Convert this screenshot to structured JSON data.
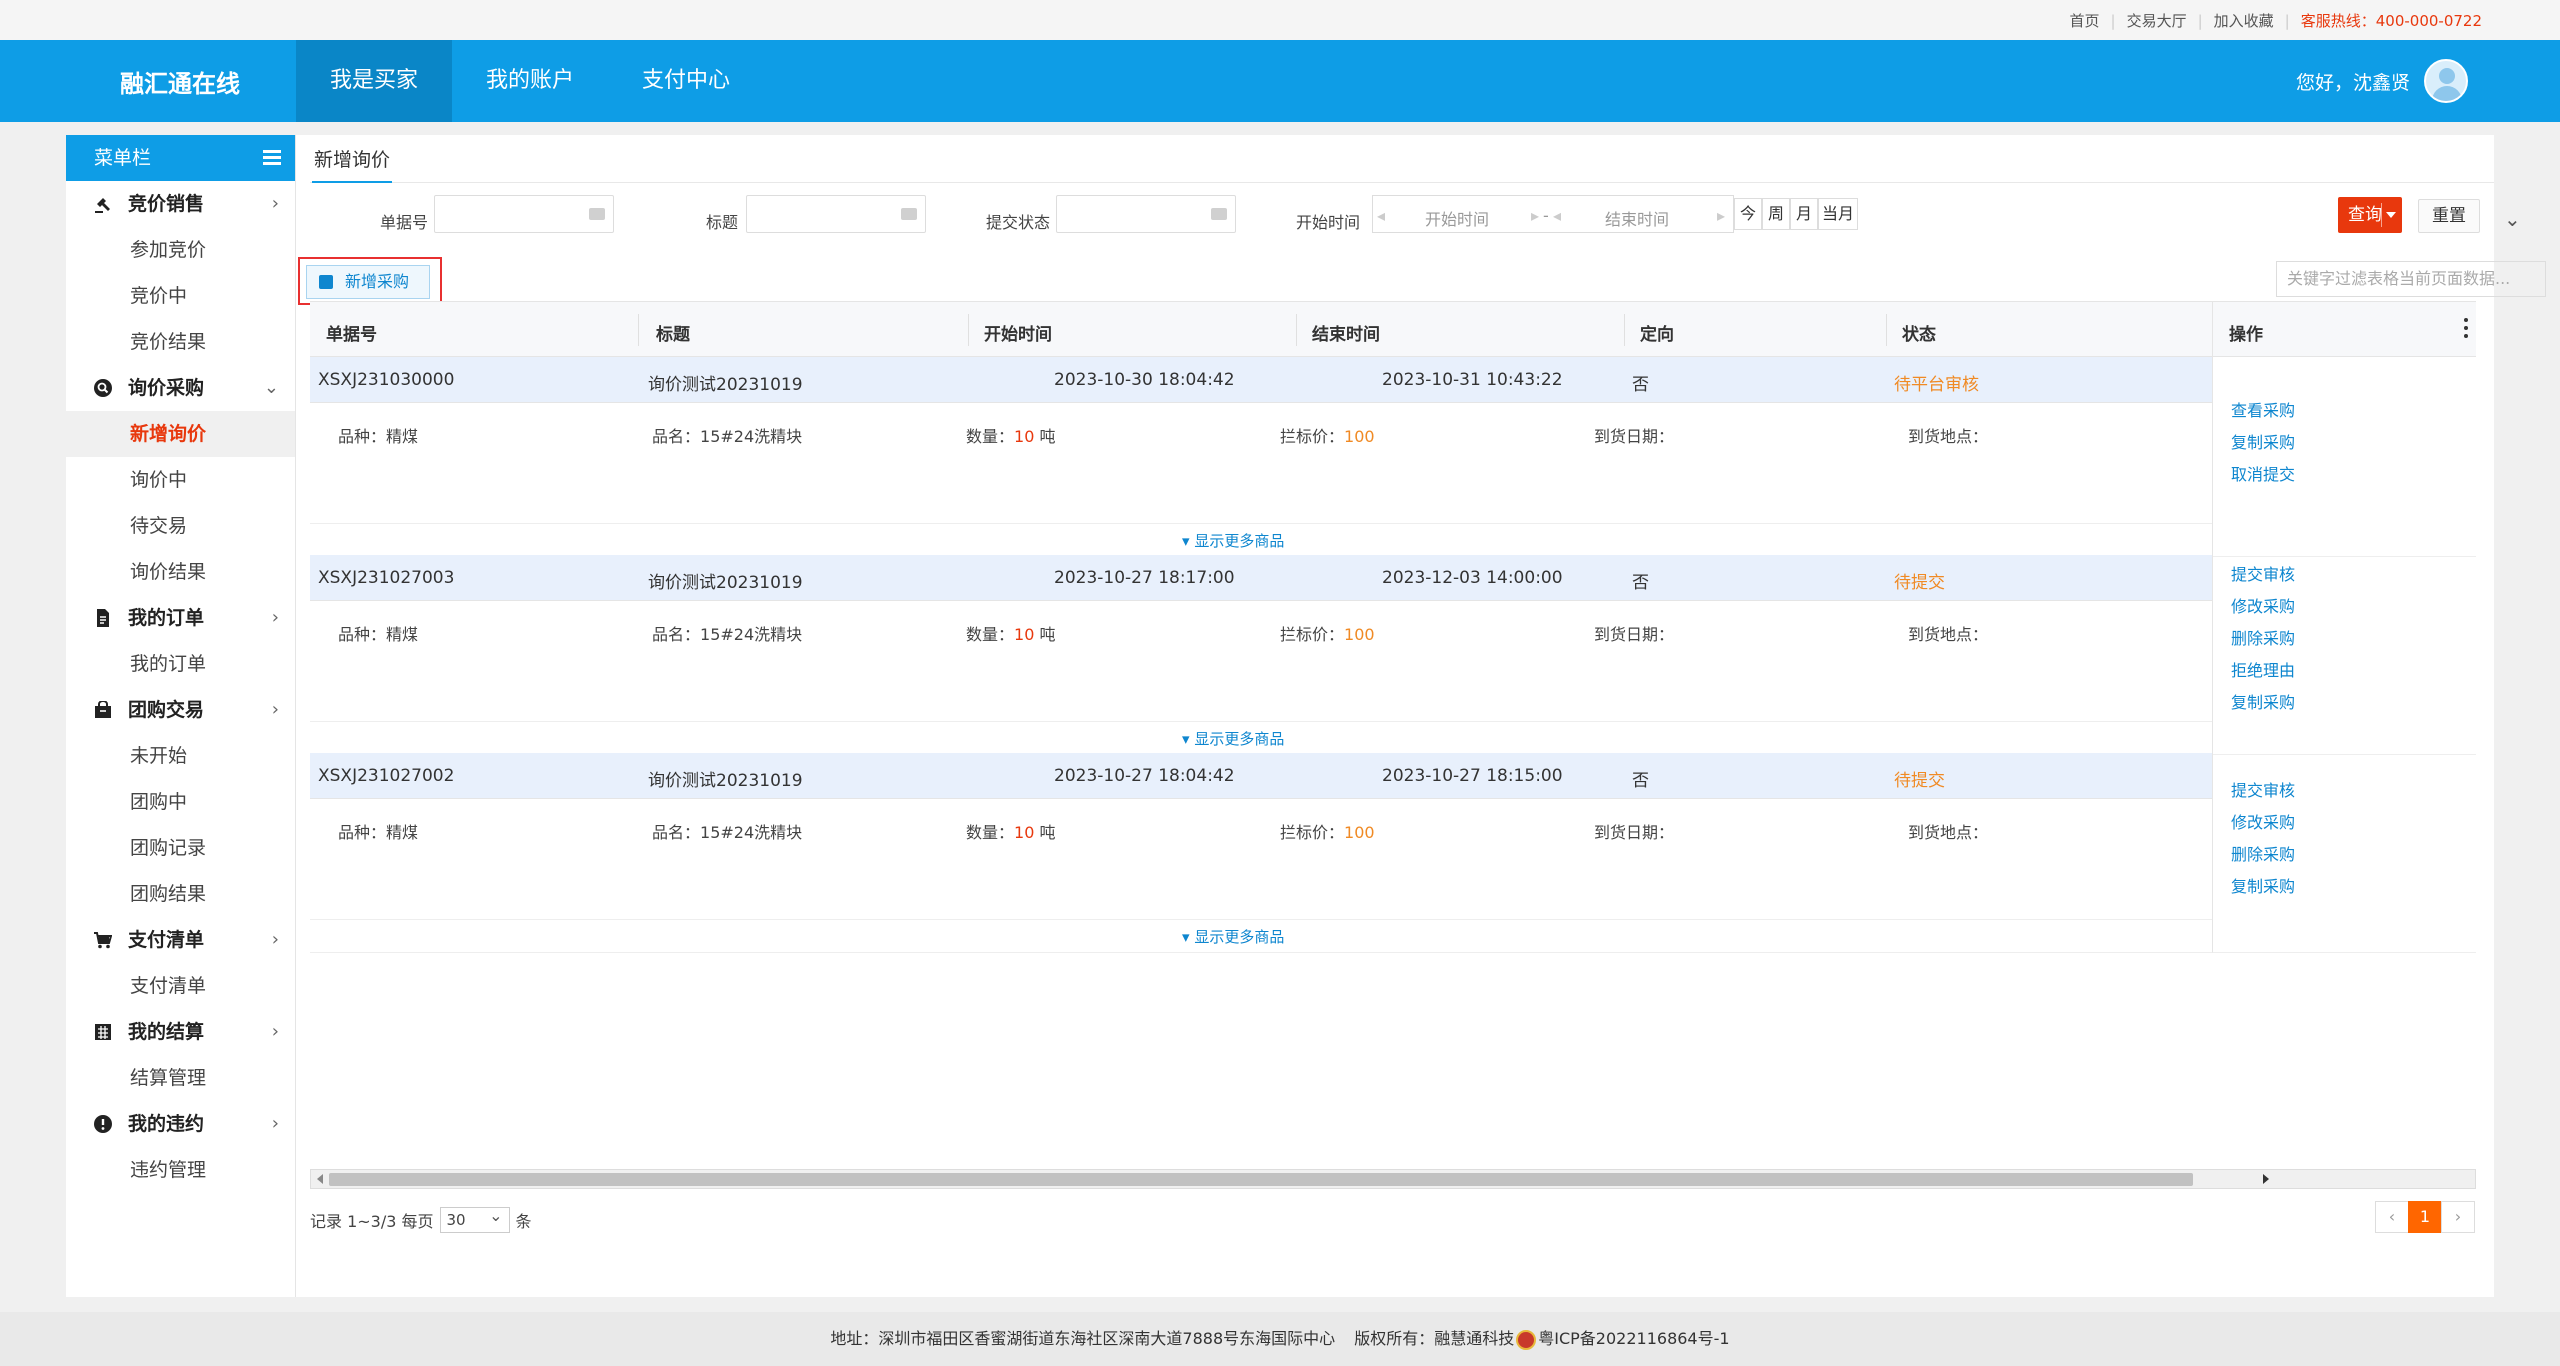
{
  "topbar": {
    "links": [
      "首页",
      "交易大厅",
      "加入收藏"
    ],
    "hotline": "客服热线：400-000-0722"
  },
  "header": {
    "logo": "融汇通在线",
    "nav": [
      "我是买家",
      "我的账户",
      "支付中心"
    ],
    "active_nav": "我是买家",
    "greeting": "您好，沈鑫贤"
  },
  "sidebar": {
    "title": "菜单栏",
    "groups": [
      {
        "label": "竞价销售",
        "items": [
          "参加竞价",
          "竞价中",
          "竞价结果"
        ]
      },
      {
        "label": "询价采购",
        "items": [
          "新增询价",
          "询价中",
          "待交易",
          "询价结果"
        ]
      },
      {
        "label": "我的订单",
        "items": [
          "我的订单"
        ]
      },
      {
        "label": "团购交易",
        "items": [
          "未开始",
          "团购中",
          "团购记录",
          "团购结果"
        ]
      },
      {
        "label": "支付清单",
        "items": [
          "支付清单"
        ]
      },
      {
        "label": "我的结算",
        "items": [
          "结算管理"
        ]
      },
      {
        "label": "我的违约",
        "items": [
          "违约管理"
        ]
      }
    ],
    "active_item": "新增询价"
  },
  "tab": "新增询价",
  "filters": {
    "order_no": "单据号",
    "title": "标题",
    "status": "提交状态",
    "start_time_label": "开始时间",
    "start_placeholder": "开始时间",
    "range_sep": "-",
    "end_placeholder": "结束时间",
    "quick": [
      "今",
      "周",
      "月",
      "当月"
    ],
    "search": "查询",
    "reset": "重置"
  },
  "add_button": "新增采购",
  "keyword_placeholder": "关键字过滤表格当前页面数据...",
  "table": {
    "columns": [
      "单据号",
      "标题",
      "开始时间",
      "结束时间",
      "定向",
      "状态",
      "操作"
    ],
    "more_label": "显示更多商品",
    "detail_labels": {
      "variety": "品种：",
      "name": "品名：",
      "qty": "数量：",
      "unit": "吨",
      "price": "拦标价：",
      "arrival_date": "到货日期：",
      "arrival_place": "到货地点："
    },
    "rows": [
      {
        "no": "XSXJ231030000",
        "title": "询价测试20231019",
        "start": "2023-10-30 18:04:42",
        "end": "2023-10-31 10:43:22",
        "directed": "否",
        "status": "待平台审核",
        "variety": "精煤",
        "name": "15#24洗精块",
        "qty": "10",
        "price": "100",
        "ops": [
          "查看采购",
          "复制采购",
          "取消提交"
        ]
      },
      {
        "no": "XSXJ231027003",
        "title": "询价测试20231019",
        "start": "2023-10-27 18:17:00",
        "end": "2023-12-03 14:00:00",
        "directed": "否",
        "status": "待提交",
        "variety": "精煤",
        "name": "15#24洗精块",
        "qty": "10",
        "price": "100",
        "ops": [
          "提交审核",
          "修改采购",
          "删除采购",
          "拒绝理由",
          "复制采购"
        ]
      },
      {
        "no": "XSXJ231027002",
        "title": "询价测试20231019",
        "start": "2023-10-27 18:04:42",
        "end": "2023-10-27 18:15:00",
        "directed": "否",
        "status": "待提交",
        "variety": "精煤",
        "name": "15#24洗精块",
        "qty": "10",
        "price": "100",
        "ops": [
          "提交审核",
          "修改采购",
          "删除采购",
          "复制采购"
        ]
      }
    ]
  },
  "pager": {
    "records": "记录 1~3/3 每页",
    "page_size": "30",
    "unit": "条",
    "prev": "‹",
    "current": "1",
    "next": "›"
  },
  "footer": {
    "address": "地址：深圳市福田区香蜜湖街道东海社区深南大道7888号东海国际中心",
    "copyright": "版权所有：融慧通科技",
    "icp": "粤ICP备2022116864号-1"
  },
  "colors": {
    "primary": "#0e9de6",
    "accent": "#e8380d",
    "status": "#f08a24",
    "link": "#0e86cf"
  }
}
